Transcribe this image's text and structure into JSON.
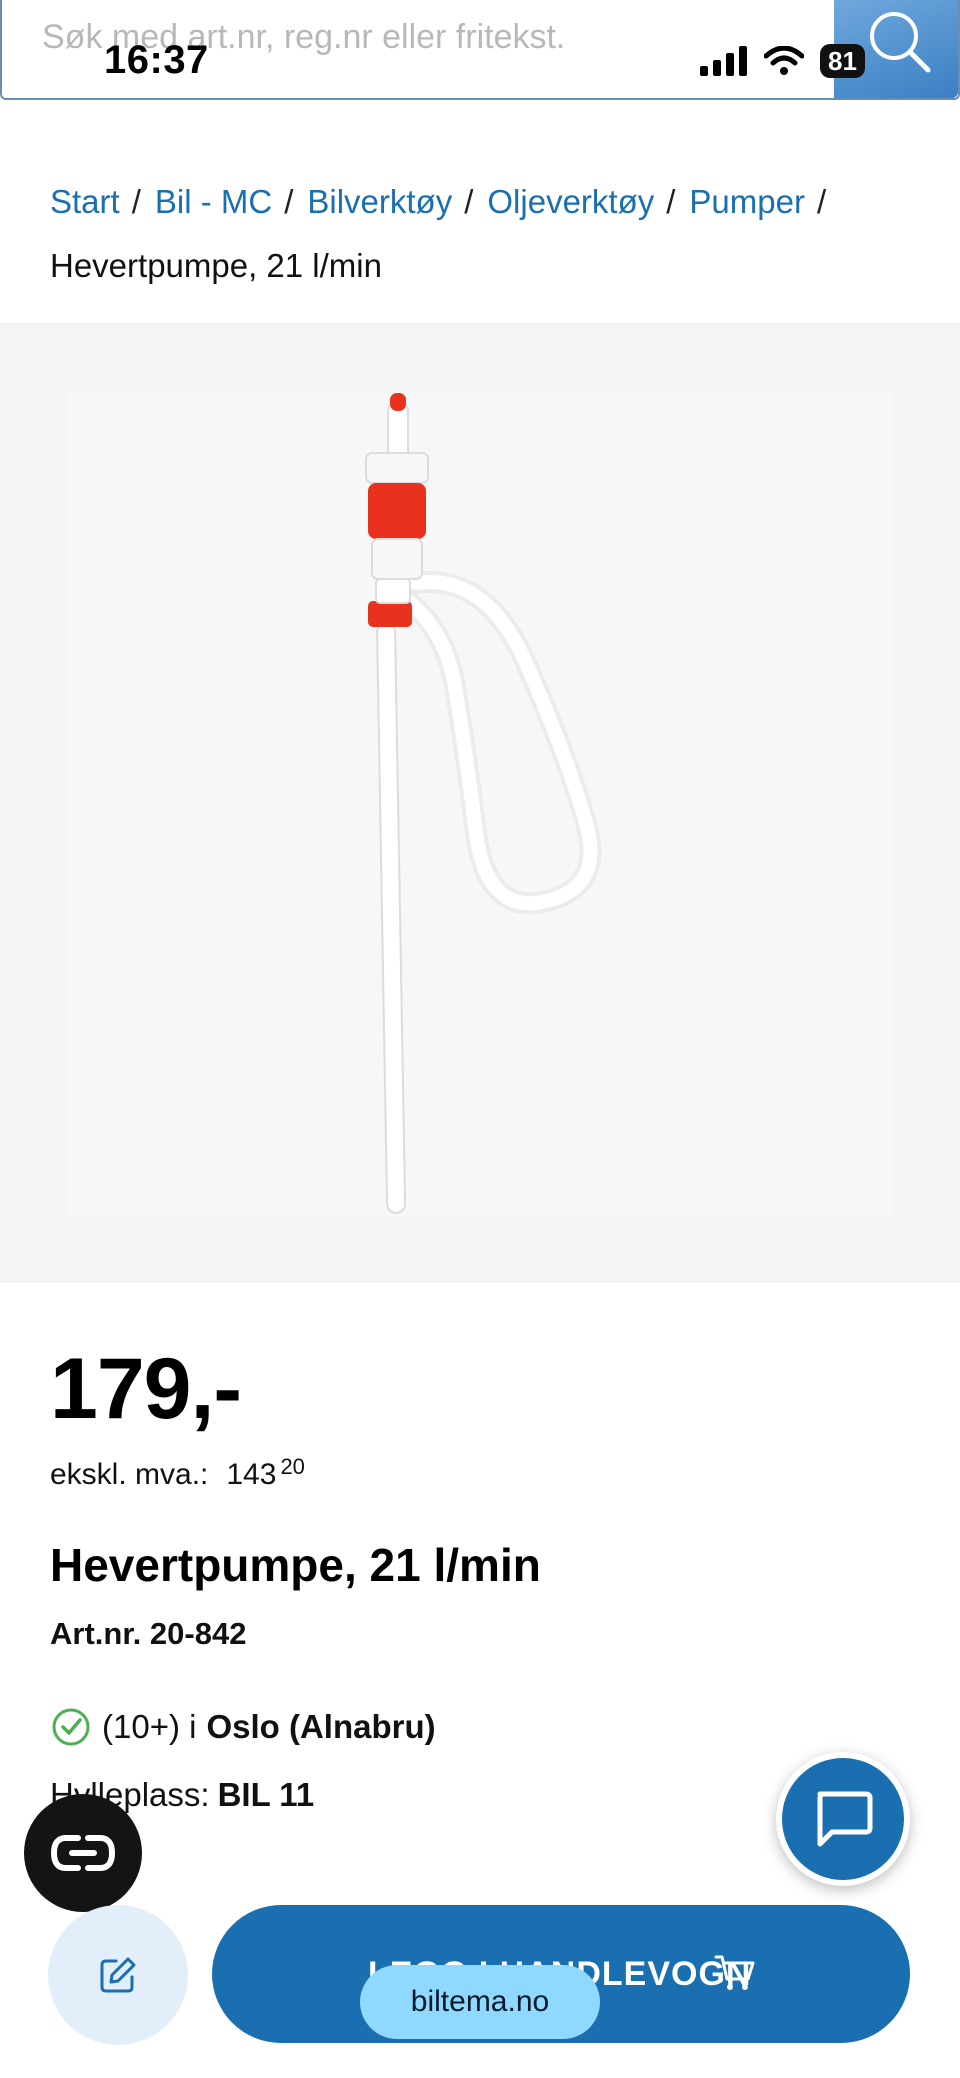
{
  "status_bar": {
    "time": "16:37",
    "battery": "81"
  },
  "search": {
    "placeholder": "Søk med art.nr, reg.nr eller fritekst."
  },
  "breadcrumb": {
    "items": [
      "Start",
      "Bil - MC",
      "Bilverktøy",
      "Oljeverktøy",
      "Pumper"
    ],
    "separator": "/",
    "current": "Hevertpumpe, 21 l/min"
  },
  "product": {
    "price": "179,-",
    "ex_vat_label": "ekskl. mva.:",
    "ex_vat_whole": "143",
    "ex_vat_cents": "20",
    "title": "Hevertpumpe, 21 l/min",
    "article_number": "Art.nr. 20-842",
    "stock_count": "(10+) i",
    "store": "Oslo (Alnabru)",
    "shelf_label": "Hylleplass:",
    "shelf_value": "BIL 11"
  },
  "actions": {
    "add_to_cart": "LEGG I HANDLEVOGN",
    "browser_url": "biltema.no"
  },
  "colors": {
    "brand_blue": "#1a6fb0",
    "link_blue": "#1a6fb0",
    "stock_green": "#4caf50",
    "pump_red": "#e8321e"
  }
}
